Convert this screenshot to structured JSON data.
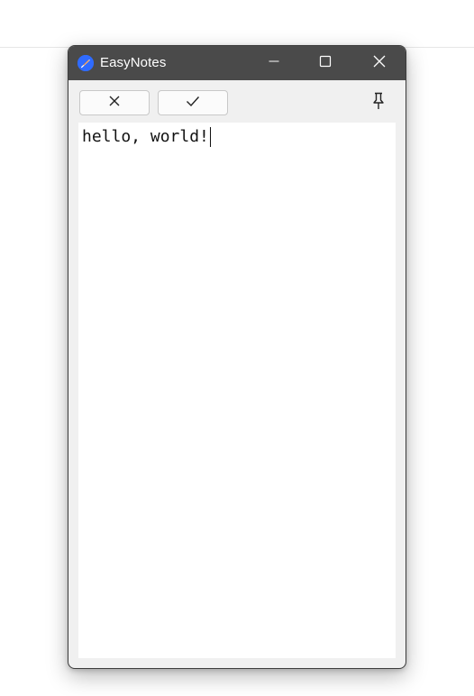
{
  "window": {
    "title": "EasyNotes",
    "app_icon": "easynotes-feather-icon",
    "controls": {
      "minimize_icon": "minimize-icon",
      "maximize_icon": "maximize-icon",
      "close_icon": "close-icon"
    }
  },
  "toolbar": {
    "cancel_icon": "x-icon",
    "confirm_icon": "check-icon",
    "pin_icon": "pin-icon"
  },
  "editor": {
    "text": "hello, world!"
  },
  "colors": {
    "titlebar": "#4a4a4a",
    "app_icon_bg": "#2f6bff",
    "window_bg": "#f0f0f0",
    "editor_bg": "#ffffff"
  }
}
